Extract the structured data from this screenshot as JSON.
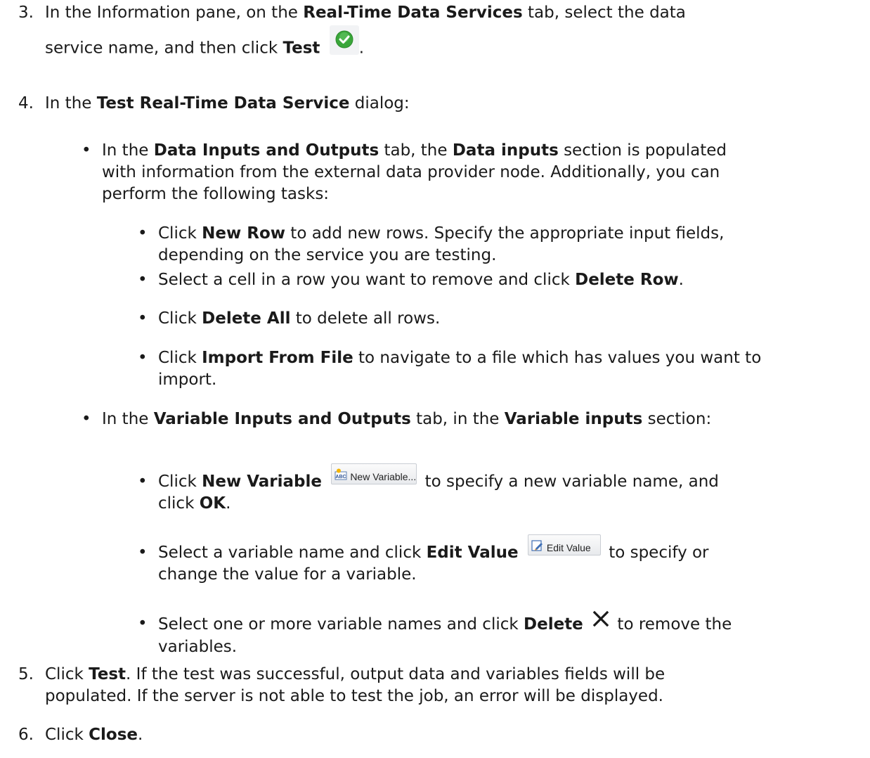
{
  "step3": {
    "number": "3.",
    "t1": "In the Information pane, on the ",
    "b1": "Real-Time Data Services",
    "t2": " tab, select the data",
    "t3": "service name, and then click ",
    "b2": "Test",
    "t4": "."
  },
  "step4": {
    "number": "4.",
    "t1": "In the ",
    "b1": "Test Real-Time Data Service",
    "t2": " dialog:",
    "bullet1": {
      "t1": "In the ",
      "b1": "Data Inputs and Outputs",
      "t2": " tab, the ",
      "b2": "Data inputs",
      "t3": " section is populated",
      "line2": "with information from the external data provider node. Additionally, you can",
      "line3": "perform the following tasks:",
      "items": [
        {
          "t1": "Click ",
          "b1": "New Row",
          "t2": " to add new rows. Specify the appropriate input fields,",
          "line2": "depending on the service you are testing."
        },
        {
          "t1": "Select a cell in a row you want to remove and click ",
          "b1": "Delete Row",
          "t2": "."
        },
        {
          "t1": "Click ",
          "b1": "Delete All",
          "t2": " to delete all rows."
        },
        {
          "t1": "Click ",
          "b1": "Import From File",
          "t2": " to navigate to a file which has values you want to",
          "line2": "import."
        }
      ]
    },
    "bullet2": {
      "t1": "In the ",
      "b1": "Variable Inputs and Outputs",
      "t2": " tab, in the ",
      "b2": "Variable inputs",
      "t3": " section:",
      "items": [
        {
          "t1": "Click ",
          "b1": "New Variable",
          "button_label": "New Variable...",
          "t2": " to specify a new variable name, and",
          "line2_t1": "click ",
          "line2_b1": "OK",
          "line2_t2": "."
        },
        {
          "t1": "Select a variable name and click ",
          "b1": "Edit Value",
          "button_label": "Edit Value",
          "t2": " to specify or",
          "line2": "change the value for a variable."
        },
        {
          "t1": "Select one or more variable names and click ",
          "b1": "Delete",
          "t2": " to remove the",
          "line2": "variables."
        }
      ]
    }
  },
  "step5": {
    "number": "5.",
    "t1": "Click ",
    "b1": "Test",
    "t2": ". If the test was successful, output data and variables fields will be",
    "line2": "populated. If the server is not able to test the job, an error will be displayed."
  },
  "step6": {
    "number": "6.",
    "t1": "Click ",
    "b1": "Close",
    "t2": "."
  },
  "bullet_glyph": "•",
  "icons": {
    "test": "green-check-circle-icon",
    "new_variable": "abc-variable-icon",
    "edit_value": "edit-pencil-icon",
    "delete": "x-delete-icon"
  },
  "colors": {
    "text": "#1a1a1a",
    "check_green": "#3aa63a"
  }
}
